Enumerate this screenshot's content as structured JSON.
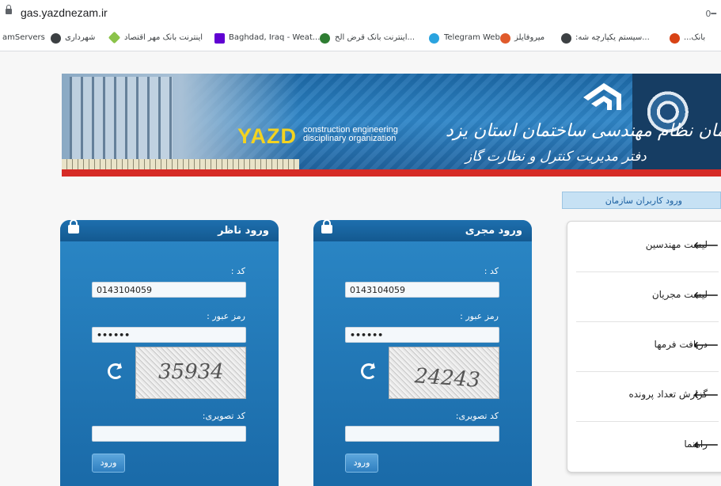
{
  "browser": {
    "url": "gas.yazdnezam.ir",
    "bookmarks": [
      "amServers",
      "شهرداری",
      "اینترنت بانک مهر اقتصاد",
      "Baghdad, Iraq - Weat...",
      "اینترنت بانک قرض الح...",
      "Telegram Web",
      "میروفایلز",
      ":سیستم یکپارچه شه...",
      "...بانک"
    ]
  },
  "banner": {
    "brand": "YAZD",
    "brand_sub_1": "construction engineering",
    "brand_sub_2": "disciplinary organization",
    "title_fa": "سازمان نظام مهندسی ساختمان استان یزد",
    "subtitle_fa": "دفتر مدیریت کنترل و نظارت گاز"
  },
  "org_login": "ورود کاربران سازمان",
  "sidebar": {
    "items": [
      "لیست مهندسین",
      "لیست مجریان",
      "دریافت فرمها",
      "گزارش تعداد پرونده",
      "راهنما"
    ]
  },
  "panels": {
    "nazer": {
      "title": "ورود ناظر",
      "code_label": "کد :",
      "code_value": "0143104059",
      "password_label": "رمز عبور :",
      "password_value": "••••••",
      "captcha_value": "35934",
      "captcha_label": "کد تصویری:",
      "captcha_input": "",
      "submit": "ورود"
    },
    "mojri": {
      "title": "ورود مجری",
      "code_label": "کد :",
      "code_value": "0143104059",
      "password_label": "رمز عبور :",
      "password_value": "••••••",
      "captcha_value": "24243",
      "captcha_label": "کد تصویری:",
      "captcha_input": "",
      "submit": "ورود"
    }
  }
}
